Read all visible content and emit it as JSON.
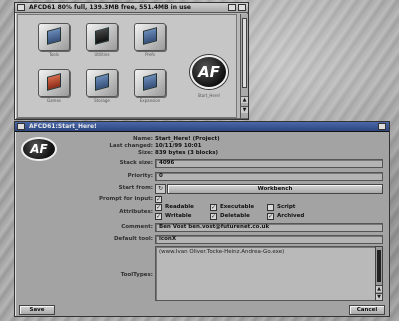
{
  "drawer": {
    "title": "AFCD61 80% full, 139.3MB free, 551.4MB in use",
    "icons": [
      {
        "name": "Tools",
        "kind": "blue"
      },
      {
        "name": "Utilities",
        "kind": "dark"
      },
      {
        "name": "Prefs",
        "kind": "blue"
      },
      {
        "name": "Games",
        "kind": "red"
      },
      {
        "name": "Storage",
        "kind": "blue"
      },
      {
        "name": "Expansion",
        "kind": "blue"
      }
    ],
    "af_logo_text": "AF",
    "af_icon_caption": "Start_Here!"
  },
  "info": {
    "title": "AFCD61:Start_Here!",
    "logo_text": "AF",
    "labels": {
      "name": "Name:",
      "last_changed": "Last changed:",
      "size": "Size:",
      "stack_size": "Stack size:",
      "priority": "Priority:",
      "start_from": "Start from:",
      "prompt_for_input": "Prompt for input:",
      "attributes": "Attributes:",
      "comment": "Comment:",
      "default_tool": "Default tool:",
      "tool_types": "ToolTypes:"
    },
    "values": {
      "name": "Start_Here! (Project)",
      "last_changed": "10/11/99 10:01",
      "size": "839 bytes (3 blocks)",
      "stack_size": "4096",
      "priority": "0",
      "start_from": "Workbench",
      "comment": "Ben Vost ben.vost@futurenet.co.uk",
      "default_tool": "iconX",
      "tooltype_line": "(www.Ivan Oliver.Tocke-Heinz.Andrea-Go.exe)"
    },
    "attributes": [
      {
        "label": "Readable",
        "checked": true
      },
      {
        "label": "Executable",
        "checked": true
      },
      {
        "label": "Script",
        "checked": false
      },
      {
        "label": "Writable",
        "checked": true
      },
      {
        "label": "Deletable",
        "checked": true
      },
      {
        "label": "Archived",
        "checked": true
      }
    ],
    "prompt_checked": true,
    "buttons": {
      "save": "Save",
      "cancel": "Cancel"
    }
  }
}
